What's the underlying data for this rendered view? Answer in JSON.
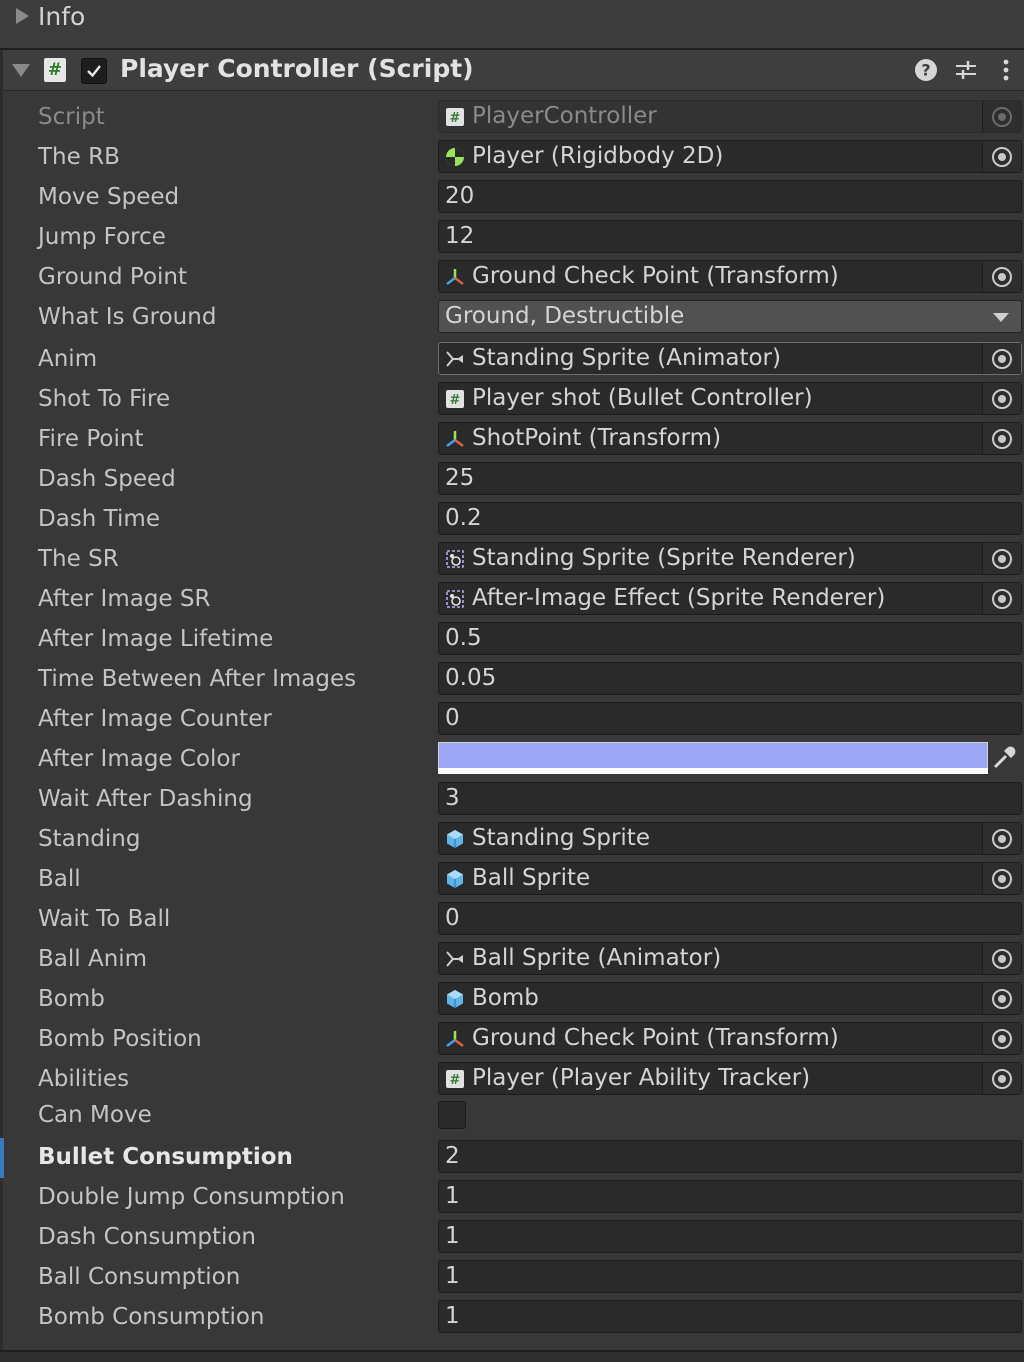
{
  "info": {
    "label": "Info"
  },
  "component": {
    "title": "Player Controller (Script)",
    "enabled": true
  },
  "colors": {
    "after_image_color": "#9da7f5",
    "selection": "#3a79bb"
  },
  "props": [
    {
      "label": "Script",
      "value": "PlayerController",
      "kind": "object",
      "icon": "script-icon",
      "disabled": true
    },
    {
      "label": "The RB",
      "value": "Player (Rigidbody 2D)",
      "kind": "object",
      "icon": "rigidbody-icon"
    },
    {
      "label": "Move Speed",
      "value": "20",
      "kind": "number"
    },
    {
      "label": "Jump Force",
      "value": "12",
      "kind": "number"
    },
    {
      "label": "Ground Point",
      "value": "Ground Check Point (Transform)",
      "kind": "object",
      "icon": "transform-icon"
    },
    {
      "label": "What Is Ground",
      "value": "Ground, Destructible",
      "kind": "dropdown"
    },
    {
      "label": "Anim",
      "value": "Standing Sprite (Animator)",
      "kind": "object",
      "icon": "animator-icon"
    },
    {
      "label": "Shot To Fire",
      "value": "Player shot (Bullet Controller)",
      "kind": "object",
      "icon": "script-icon"
    },
    {
      "label": "Fire Point",
      "value": "ShotPoint (Transform)",
      "kind": "object",
      "icon": "transform-icon"
    },
    {
      "label": "Dash Speed",
      "value": "25",
      "kind": "number"
    },
    {
      "label": "Dash Time",
      "value": "0.2",
      "kind": "number"
    },
    {
      "label": "The SR",
      "value": "Standing Sprite (Sprite Renderer)",
      "kind": "object",
      "icon": "sprite-renderer-icon"
    },
    {
      "label": "After Image SR",
      "value": "After-Image Effect (Sprite Renderer)",
      "kind": "object",
      "icon": "sprite-renderer-icon"
    },
    {
      "label": "After Image Lifetime",
      "value": "0.5",
      "kind": "number"
    },
    {
      "label": "Time Between After Images",
      "value": "0.05",
      "kind": "number"
    },
    {
      "label": "After Image Counter",
      "value": "0",
      "kind": "number"
    },
    {
      "label": "After Image Color",
      "value": "",
      "kind": "color"
    },
    {
      "label": "Wait After Dashing",
      "value": "3",
      "kind": "number"
    },
    {
      "label": "Standing",
      "value": "Standing Sprite",
      "kind": "object",
      "icon": "prefab-icon"
    },
    {
      "label": "Ball",
      "value": "Ball Sprite",
      "kind": "object",
      "icon": "prefab-icon"
    },
    {
      "label": "Wait To Ball",
      "value": "0",
      "kind": "number"
    },
    {
      "label": "Ball Anim",
      "value": "Ball Sprite (Animator)",
      "kind": "object",
      "icon": "animator-icon"
    },
    {
      "label": "Bomb",
      "value": "Bomb",
      "kind": "object",
      "icon": "prefab-icon"
    },
    {
      "label": "Bomb Position",
      "value": "Ground Check Point (Transform)",
      "kind": "object",
      "icon": "transform-icon"
    },
    {
      "label": "Abilities",
      "value": "Player (Player Ability Tracker)",
      "kind": "object",
      "icon": "script-icon"
    },
    {
      "label": "Can Move",
      "value": "",
      "kind": "toggle"
    },
    {
      "label": "Bullet Consumption",
      "value": "2",
      "kind": "number",
      "bold": true
    },
    {
      "label": "Double Jump Consumption",
      "value": "1",
      "kind": "number"
    },
    {
      "label": "Dash Consumption",
      "value": "1",
      "kind": "number"
    },
    {
      "label": "Ball Consumption",
      "value": "1",
      "kind": "number"
    },
    {
      "label": "Bomb Consumption",
      "value": "1",
      "kind": "number"
    }
  ]
}
